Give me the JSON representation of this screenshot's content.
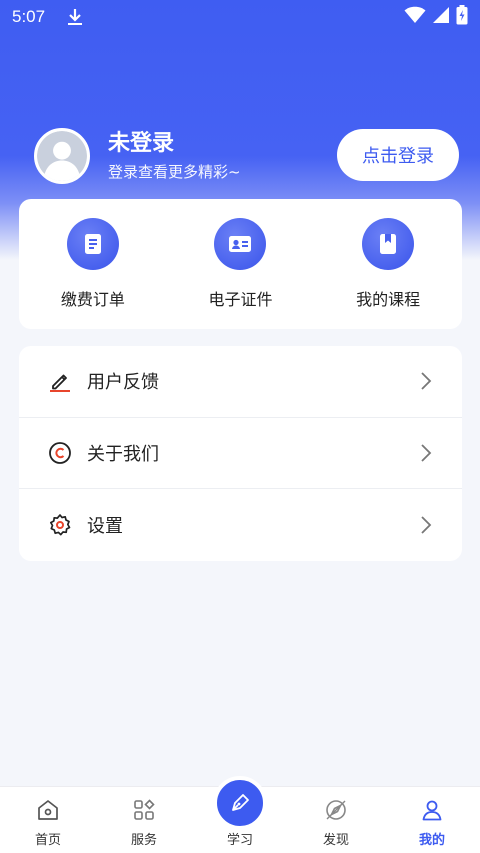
{
  "status": {
    "time": "5:07"
  },
  "profile": {
    "name": "未登录",
    "subtitle": "登录查看更多精彩~",
    "login_button": "点击登录"
  },
  "quick_actions": [
    {
      "label": "缴费订单",
      "icon": "document-icon"
    },
    {
      "label": "电子证件",
      "icon": "id-card-icon"
    },
    {
      "label": "我的课程",
      "icon": "bookmark-book-icon"
    }
  ],
  "menu": [
    {
      "label": "用户反馈",
      "icon": "pencil-icon"
    },
    {
      "label": "关于我们",
      "icon": "copyright-icon"
    },
    {
      "label": "设置",
      "icon": "gear-icon"
    }
  ],
  "tabs": [
    {
      "label": "首页",
      "icon": "home-icon"
    },
    {
      "label": "服务",
      "icon": "grid-icon"
    },
    {
      "label": "学习",
      "icon": "pen-nib-icon"
    },
    {
      "label": "发现",
      "icon": "compass-icon"
    },
    {
      "label": "我的",
      "icon": "user-icon",
      "active": true
    }
  ],
  "colors": {
    "brand": "#3d5bf0",
    "background": "#f4f6fb",
    "accent_red": "#e8452c"
  }
}
